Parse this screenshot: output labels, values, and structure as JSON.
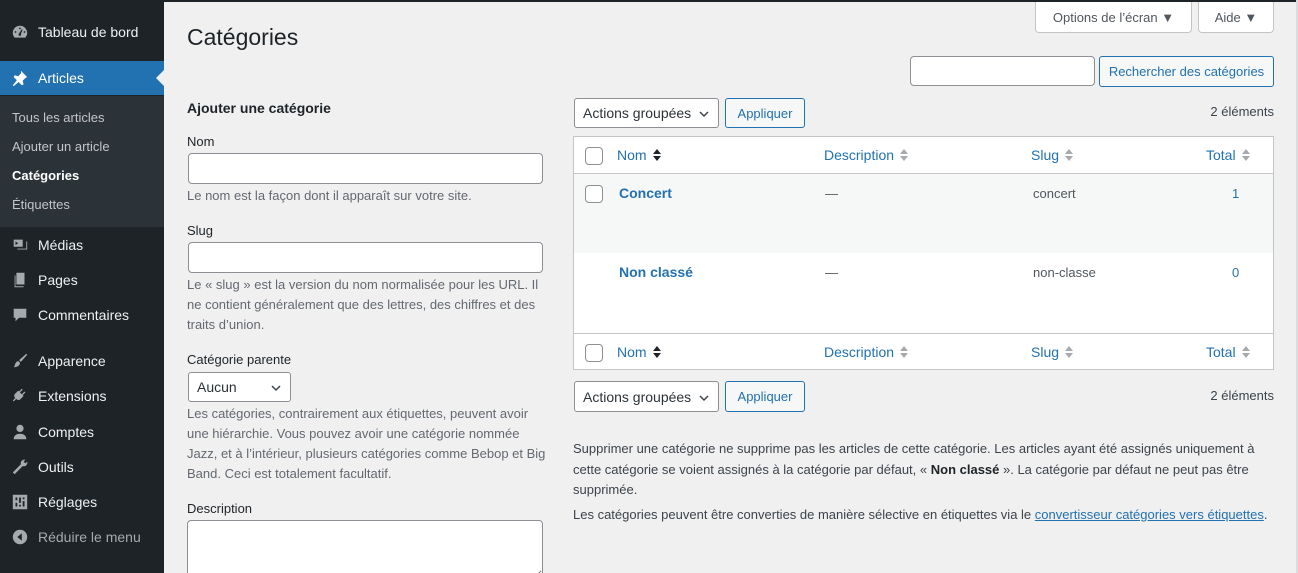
{
  "sidebar": {
    "dashboard": "Tableau de bord",
    "posts": "Articles",
    "posts_sub": [
      "Tous les articles",
      "Ajouter un article",
      "Catégories",
      "Étiquettes"
    ],
    "media": "Médias",
    "pages": "Pages",
    "comments": "Commentaires",
    "appearance": "Apparence",
    "plugins": "Extensions",
    "users": "Comptes",
    "tools": "Outils",
    "settings": "Réglages",
    "collapse": "Réduire le menu"
  },
  "header": {
    "title": "Catégories",
    "screen_options": "Options de l’écran ▼",
    "help": "Aide ▼"
  },
  "search": {
    "button": "Rechercher des catégories",
    "value": ""
  },
  "form": {
    "heading": "Ajouter une catégorie",
    "name_label": "Nom",
    "name_help": "Le nom est la façon dont il apparaît sur votre site.",
    "slug_label": "Slug",
    "slug_help": "Le « slug » est la version du nom normalisée pour les URL. Il ne contient généralement que des lettres, des chiffres et des traits d’union.",
    "parent_label": "Catégorie parente",
    "parent_value": "Aucun",
    "parent_help": "Les catégories, contrairement aux étiquettes, peuvent avoir une hiérarchie. Vous pouvez avoir une catégorie nommée Jazz, et à l’intérieur, plusieurs catégories comme Bebop et Big Band. Ceci est totalement facultatif.",
    "description_label": "Description"
  },
  "bulk": {
    "select": "Actions groupées",
    "apply": "Appliquer",
    "count": "2 éléments"
  },
  "table": {
    "columns": {
      "name": "Nom",
      "description": "Description",
      "slug": "Slug",
      "count": "Total"
    },
    "rows": [
      {
        "name": "Concert",
        "description": "—",
        "slug": "concert",
        "count": "1"
      },
      {
        "name": "Non classé",
        "description": "—",
        "slug": "non-classe",
        "count": "0"
      }
    ]
  },
  "notes": {
    "p1_a": "Supprimer une catégorie ne supprime pas les articles de cette catégorie. Les articles ayant été assignés uniquement à cette catégorie se voient assignés à la catégorie par défaut, « ",
    "p1_b": "Non classé",
    "p1_c": " ». La catégorie par défaut ne peut pas être supprimée.",
    "p2_a": "Les catégories peuvent être converties de manière sélective en étiquettes via le ",
    "p2_link": "convertisseur catégories vers étiquettes",
    "p2_b": "."
  },
  "colors": {
    "accent": "#2271b1",
    "sidebar_bg": "#1d2327",
    "submenu_bg": "#2c3338",
    "page_bg": "#f0f0f1"
  }
}
